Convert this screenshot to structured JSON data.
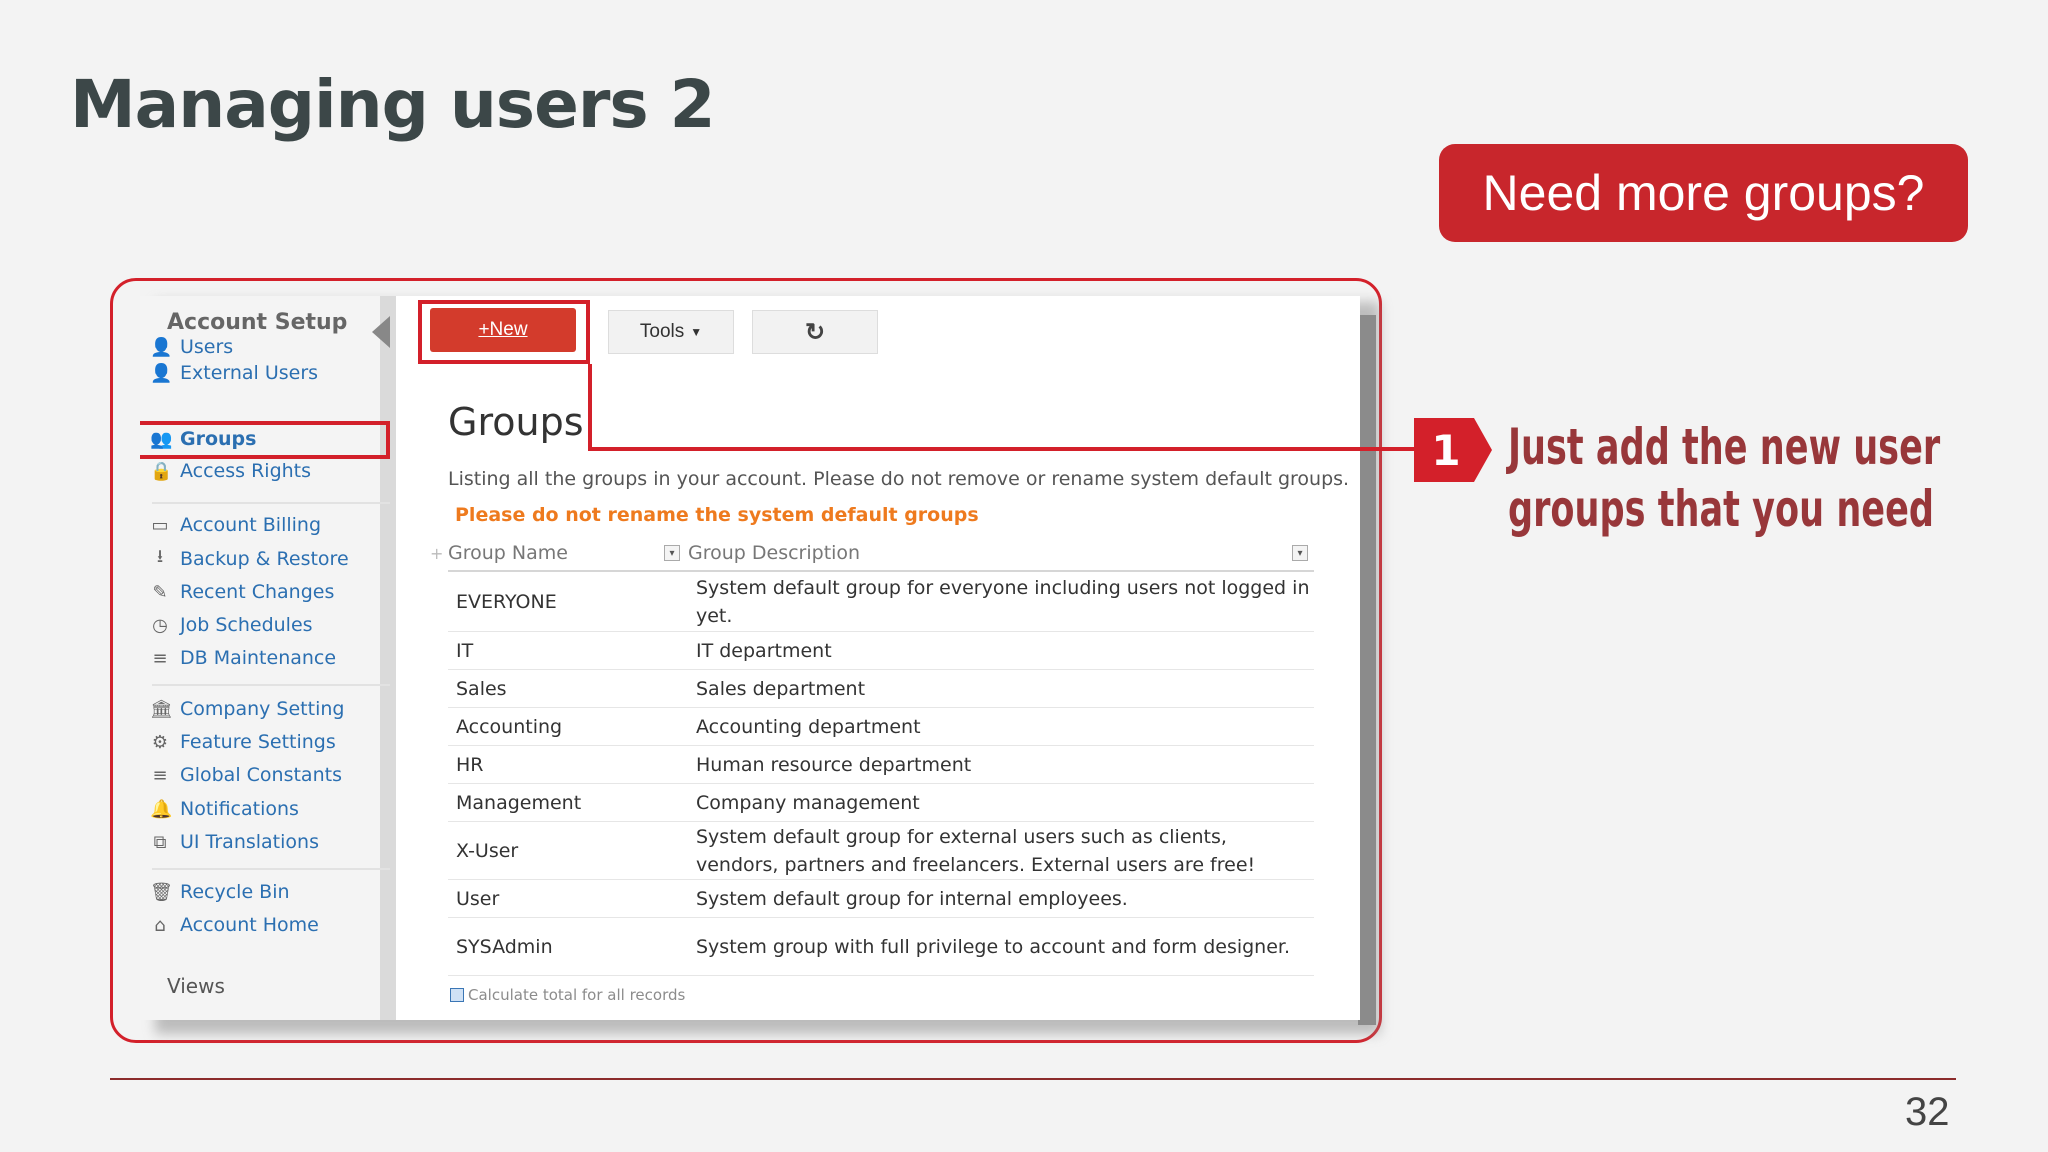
{
  "slide": {
    "title": "Managing users 2",
    "badge": "Need more groups?",
    "callout_number": "1",
    "callout_line1": "Just add the new user",
    "callout_line2": "groups that you need",
    "page_number": "32"
  },
  "sidebar": {
    "header": "Account Setup",
    "items": [
      {
        "label": "Users",
        "icon": "user-icon"
      },
      {
        "label": "External Users",
        "icon": "user-icon"
      },
      {
        "label": "Groups",
        "icon": "groups-icon"
      },
      {
        "label": "Access Rights",
        "icon": "lock-icon"
      },
      {
        "label": "Account Billing",
        "icon": "card-icon"
      },
      {
        "label": "Backup & Restore",
        "icon": "download-icon"
      },
      {
        "label": "Recent Changes",
        "icon": "edit-icon"
      },
      {
        "label": "Job Schedules",
        "icon": "clock-icon"
      },
      {
        "label": "DB Maintenance",
        "icon": "database-icon"
      },
      {
        "label": "Company Setting",
        "icon": "bank-icon"
      },
      {
        "label": "Feature Settings",
        "icon": "gear-icon"
      },
      {
        "label": "Global Constants",
        "icon": "database-icon"
      },
      {
        "label": "Notifications",
        "icon": "bell-icon"
      },
      {
        "label": "UI Translations",
        "icon": "translate-icon"
      },
      {
        "label": "Recycle Bin",
        "icon": "trash-icon"
      },
      {
        "label": "Account Home",
        "icon": "home-icon"
      }
    ],
    "views_label": "Views"
  },
  "toolbar": {
    "new_label": "+New",
    "tools_label": "Tools",
    "refresh_icon": "refresh-icon"
  },
  "page": {
    "heading": "Groups",
    "description": "Listing all the groups in your account. Please do not remove or rename system default groups.",
    "warning": "Please do not rename the system default groups"
  },
  "grid": {
    "columns": [
      "Group Name",
      "Group Description"
    ],
    "rows": [
      [
        "EVERYONE",
        "System default group for everyone including users not logged in yet."
      ],
      [
        "IT",
        "IT department"
      ],
      [
        "Sales",
        "Sales department"
      ],
      [
        "Accounting",
        "Accounting department"
      ],
      [
        "HR",
        "Human resource department"
      ],
      [
        "Management",
        "Company management"
      ],
      [
        "X-User",
        "System default group for external users such as clients, vendors, partners and freelancers. External users are free!"
      ],
      [
        "User",
        "System default group for internal employees."
      ],
      [
        "SYSAdmin",
        "System group with full privilege to account and form designer."
      ]
    ],
    "footer": "Calculate total for all records"
  },
  "colors": {
    "accent_red": "#d3202a",
    "badge_red": "#c8262c",
    "callout_text": "#98373a",
    "link_blue": "#2b6fb1",
    "warning_orange": "#ee7a1e"
  }
}
